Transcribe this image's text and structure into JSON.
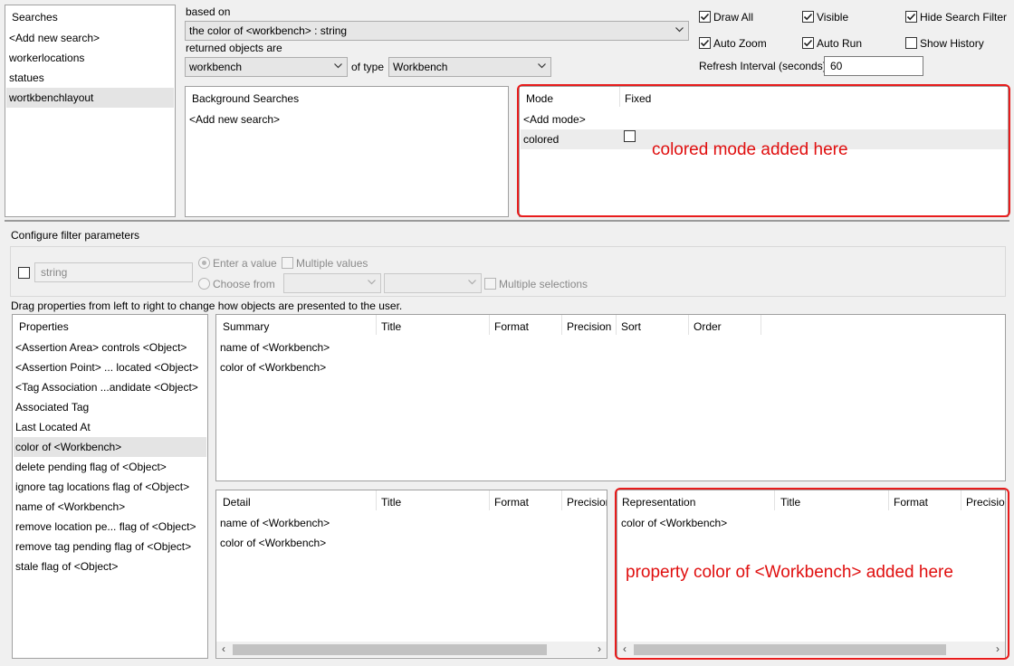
{
  "searches": {
    "header": "Searches",
    "items": [
      "<Add new search>",
      "workerlocations",
      "statues",
      "wortkbenchlayout"
    ],
    "selected_index": 3
  },
  "based_on": {
    "label": "based on",
    "value": "the color of <workbench> : string"
  },
  "returned": {
    "label": "returned objects are",
    "value": "workbench",
    "of_type_label": "of type",
    "type_value": "Workbench"
  },
  "options": {
    "draw_all": {
      "label": "Draw All",
      "checked": true
    },
    "visible": {
      "label": "Visible",
      "checked": true
    },
    "hide_search_filter": {
      "label": "Hide Search Filter",
      "checked": true
    },
    "auto_zoom": {
      "label": "Auto Zoom",
      "checked": true
    },
    "auto_run": {
      "label": "Auto Run",
      "checked": true
    },
    "show_history": {
      "label": "Show History",
      "checked": false
    },
    "refresh_label": "Refresh Interval (seconds)",
    "refresh_value": "60"
  },
  "background_searches": {
    "header": "Background Searches",
    "items": [
      "<Add new search>"
    ]
  },
  "modes": {
    "col_mode": "Mode",
    "col_fixed": "Fixed",
    "rows": [
      {
        "mode": "<Add mode>"
      },
      {
        "mode": "colored",
        "fixed": false
      }
    ]
  },
  "annotations": {
    "colored_mode": "colored mode added here",
    "property_added": "property color of <Workbench> added here"
  },
  "filter": {
    "title": "Configure filter parameters",
    "type_value": "string",
    "enter_value_label": "Enter a value",
    "multiple_values_label": "Multiple values",
    "choose_from_label": "Choose from",
    "multiple_selections_label": "Multiple selections"
  },
  "drag_hint": "Drag properties from left to right to change how objects are presented to the user.",
  "properties": {
    "header": "Properties",
    "items": [
      "<Assertion Area> controls <Object>",
      "<Assertion Point> ... located <Object>",
      "<Tag Association ...andidate <Object>",
      "Associated Tag",
      "Last Located At",
      "color of <Workbench>",
      "delete pending flag of <Object>",
      "ignore tag locations flag of <Object>",
      "name of <Workbench>",
      "remove location pe... flag of <Object>",
      "remove tag pending flag of <Object>",
      "stale flag of <Object>"
    ],
    "selected_index": 5
  },
  "summary": {
    "columns": [
      "Summary",
      "Title",
      "Format",
      "Precision",
      "Sort",
      "Order"
    ],
    "rows": [
      "name of <Workbench>",
      "color of <Workbench>"
    ]
  },
  "detail": {
    "columns": [
      "Detail",
      "Title",
      "Format",
      "Precision"
    ],
    "rows": [
      "name of <Workbench>",
      "color of <Workbench>"
    ]
  },
  "representation": {
    "columns": [
      "Representation",
      "Title",
      "Format",
      "Precision"
    ],
    "rows": [
      "color of <Workbench>"
    ]
  }
}
